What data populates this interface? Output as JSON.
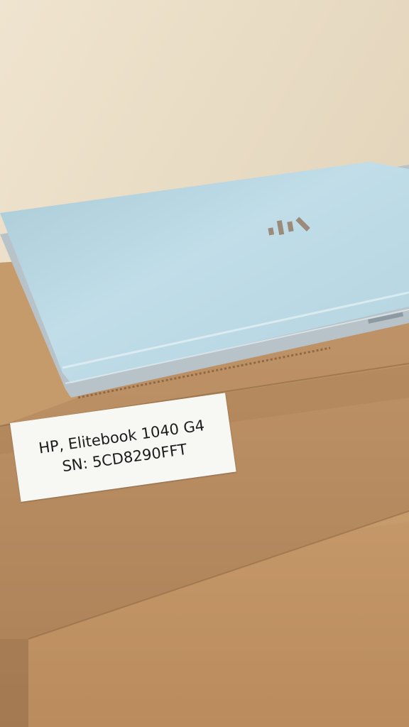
{
  "photo": {
    "subject": "HP laptop lying closed on stacked cardboard boxes",
    "colors": {
      "wall": "#e6d9c2",
      "laptop_lid": "#b7d6e2",
      "cardboard": "#b98b5b",
      "label_bg": "#f7f7f4",
      "logo": "#9a8b7a"
    },
    "logo_icon": "hp-logo-icon"
  },
  "label": {
    "line1": "HP, Elitebook 1040 G4",
    "line2": "SN: 5CD8290FFT"
  }
}
